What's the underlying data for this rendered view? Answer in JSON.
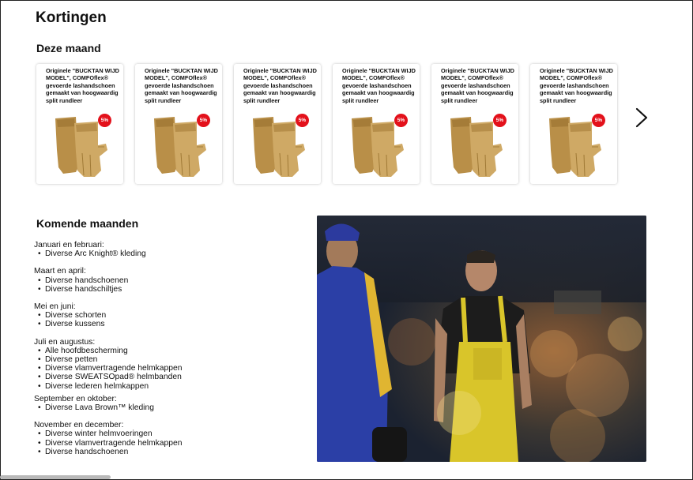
{
  "page": {
    "title": "Kortingen"
  },
  "this_month": {
    "title": "Deze maand",
    "products": [
      {
        "name": "Originele \"BUCKTAN WIJD MODEL\", COMFOflex® gevoerde lashandschoen gemaakt van hoogwaardig split rundleer",
        "discount": "5%"
      },
      {
        "name": "Originele \"BUCKTAN WIJD MODEL\", COMFOflex® gevoerde lashandschoen gemaakt van hoogwaardig split rundleer",
        "discount": "5%"
      },
      {
        "name": "Originele \"BUCKTAN WIJD MODEL\", COMFOflex® gevoerde lashandschoen gemaakt van hoogwaardig split rundleer",
        "discount": "5%"
      },
      {
        "name": "Originele \"BUCKTAN WIJD MODEL\", COMFOflex® gevoerde lashandschoen gemaakt van hoogwaardig split rundleer",
        "discount": "5%"
      },
      {
        "name": "Originele \"BUCKTAN WIJD MODEL\", COMFOflex® gevoerde lashandschoen gemaakt van hoogwaardig split rundleer",
        "discount": "5%"
      },
      {
        "name": "Originele \"BUCKTAN WIJD MODEL\", COMFOflex® gevoerde lashandschoen gemaakt van hoogwaardig split rundleer",
        "discount": "5%"
      }
    ],
    "next_icon": "chevron-right-icon"
  },
  "upcoming": {
    "title": "Komende maanden",
    "groups": [
      {
        "label": "Januari en februari:",
        "items": [
          "Diverse Arc Knight® kleding"
        ]
      },
      {
        "label": "Maart en april:",
        "items": [
          "Diverse handschoenen",
          "Diverse handschiltjes"
        ]
      },
      {
        "label": "Mei en juni:",
        "items": [
          "Diverse schorten",
          "Diverse kussens"
        ]
      },
      {
        "label": "Juli en augustus:",
        "items": [
          "Alle hoofdbescherming",
          "Diverse petten",
          "Diverse vlamvertragende helmkappen",
          "Diverse SWEATSOpad® helmbanden",
          "Diverse lederen helmkappen"
        ]
      },
      {
        "label": "September en oktober:",
        "items": [
          "Diverse Lava Brown™ kleding"
        ]
      },
      {
        "label": "November en december:",
        "items": [
          "Diverse winter helmvoeringen",
          "Diverse vlamvertragende helmkappen",
          "Diverse handschoenen"
        ]
      }
    ]
  },
  "colors": {
    "badge": "#e3111b",
    "glove": "#c9a25c",
    "apron": "#d9c52a",
    "jacket": "#2b3fa6"
  }
}
